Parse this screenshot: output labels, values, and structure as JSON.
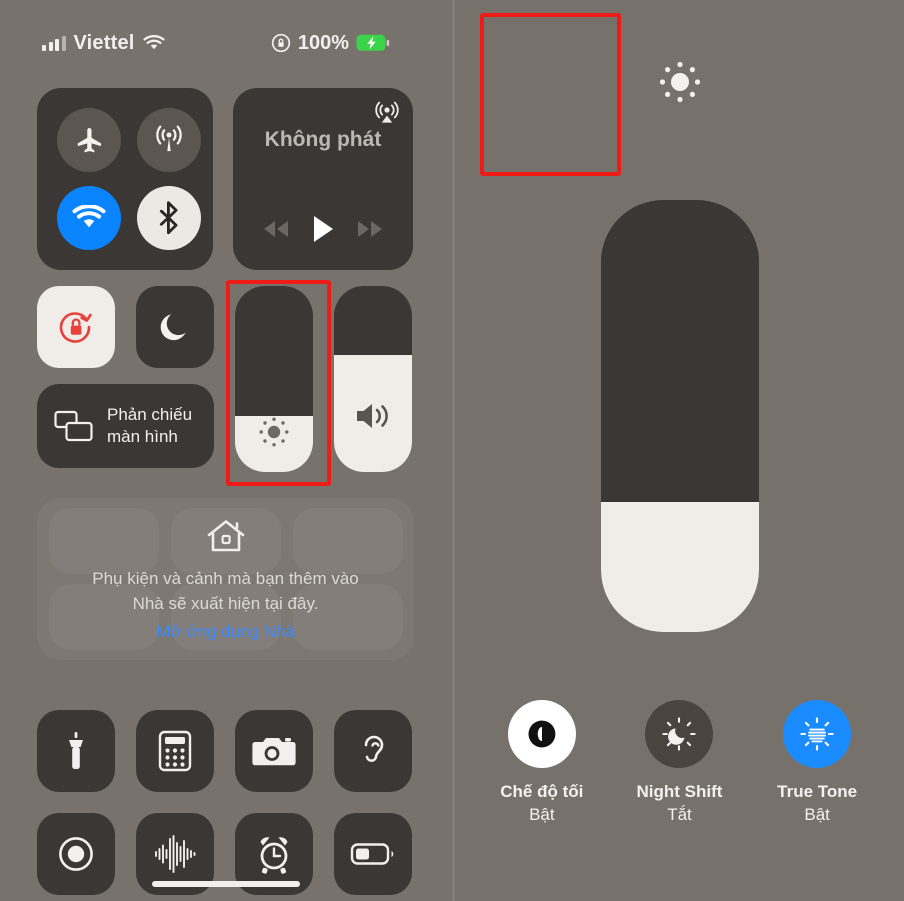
{
  "status_bar": {
    "signal_icon": "cellular-bars-icon",
    "carrier": "Viettel",
    "wifi_icon": "wifi-icon",
    "rotation_lock_icon": "rotation-lock-icon",
    "battery_percent": "100%",
    "battery_icon": "battery-charging-icon",
    "battery_color": "#3ad34a"
  },
  "left_panel": {
    "connectivity": {
      "airplane": {
        "label": "airplane-mode",
        "state": "off",
        "color": "#5c5651"
      },
      "cellular": {
        "label": "cellular-data",
        "state": "off",
        "color": "#5c5651"
      },
      "wifi": {
        "label": "wifi",
        "state": "on",
        "color": "#0b84ff"
      },
      "bluetooth": {
        "label": "bluetooth",
        "state": "on",
        "color": "#ece8e4"
      }
    },
    "media": {
      "title": "Không phát",
      "airplay_icon": "airplay-audio-icon",
      "rewind_icon": "rewind-icon",
      "play_icon": "play-icon",
      "forward_icon": "fast-forward-icon"
    },
    "rotation_lock": {
      "name": "rotation-lock",
      "state": "on",
      "color": "#e8413c"
    },
    "do_not_disturb": {
      "name": "focus-moon",
      "state": "off"
    },
    "screen_mirroring": {
      "label": "Phản chiếu\nmàn hình",
      "line1": "Phản chiếu",
      "line2": "màn hình"
    },
    "brightness_slider": {
      "name": "brightness",
      "value_pct": 30,
      "icon": "brightness-sun-icon"
    },
    "volume_slider": {
      "name": "volume",
      "value_pct": 63,
      "icon": "speaker-icon"
    },
    "home_card": {
      "icon": "house-icon",
      "line1": "Phụ kiện và cảnh mà bạn thêm vào",
      "line2": "Nhà sẽ xuất hiện tại đây.",
      "link": "Mở ứng dụng Nhà",
      "link_color": "#3d8bfd"
    },
    "shortcut_grid": [
      {
        "name": "flashlight-icon",
        "label": "Flashlight"
      },
      {
        "name": "calculator-icon",
        "label": "Calculator"
      },
      {
        "name": "camera-icon",
        "label": "Camera"
      },
      {
        "name": "hearing-ear-icon",
        "label": "Hearing"
      },
      {
        "name": "screen-record-icon",
        "label": "Screen Record"
      },
      {
        "name": "sound-recognition-icon",
        "label": "Sound Recognition"
      },
      {
        "name": "alarm-clock-icon",
        "label": "Alarm"
      },
      {
        "name": "low-power-battery-icon",
        "label": "Low Power Mode"
      }
    ]
  },
  "right_panel": {
    "brightness_top_icon": "brightness-sun-icon",
    "brightness_slider": {
      "name": "brightness-expanded",
      "value_pct": 30
    },
    "display_options": [
      {
        "name": "dark-mode",
        "icon": "dark-mode-icon",
        "label": "Chế độ tối",
        "state": "Bật",
        "circle_color": "#ffffff",
        "active": true
      },
      {
        "name": "night-shift",
        "icon": "night-shift-icon",
        "label": "Night Shift",
        "state": "Tắt",
        "circle_color": "#4a443f",
        "active": false
      },
      {
        "name": "true-tone",
        "icon": "true-tone-icon",
        "label": "True Tone",
        "state": "Bật",
        "circle_color": "#1a8cff",
        "active": true
      }
    ]
  },
  "annotations": {
    "highlight_color": "#ee1b17",
    "boxes": [
      {
        "name": "brightness-slider-highlight"
      },
      {
        "name": "dark-mode-highlight"
      }
    ],
    "arrow": {
      "name": "pointer-arrow",
      "points_to": "dark-mode"
    }
  }
}
